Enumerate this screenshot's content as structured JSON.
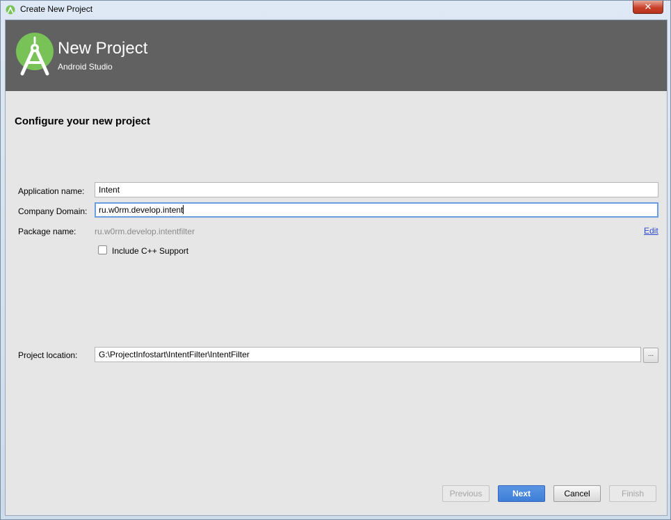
{
  "window": {
    "title": "Create New Project",
    "close_label": "✕"
  },
  "banner": {
    "title": "New Project",
    "subtitle": "Android Studio",
    "colors": {
      "background": "#616161",
      "logo": "#78c257"
    }
  },
  "form": {
    "heading": "Configure your new project",
    "application_name": {
      "label": "Application name:",
      "value": "Intent"
    },
    "company_domain": {
      "label": "Company Domain:",
      "value": "ru.w0rm.develop.intent"
    },
    "package_name": {
      "label": "Package name:",
      "value": "ru.w0rm.develop.intentfilter",
      "edit_label": "Edit"
    },
    "cpp_support": {
      "label": "Include C++ Support",
      "checked": false
    },
    "project_location": {
      "label": "Project location:",
      "value": "G:\\ProjectInfostart\\IntentFilter\\IntentFilter",
      "browse_label": "..."
    }
  },
  "buttons": {
    "previous": "Previous",
    "next": "Next",
    "cancel": "Cancel",
    "finish": "Finish"
  }
}
